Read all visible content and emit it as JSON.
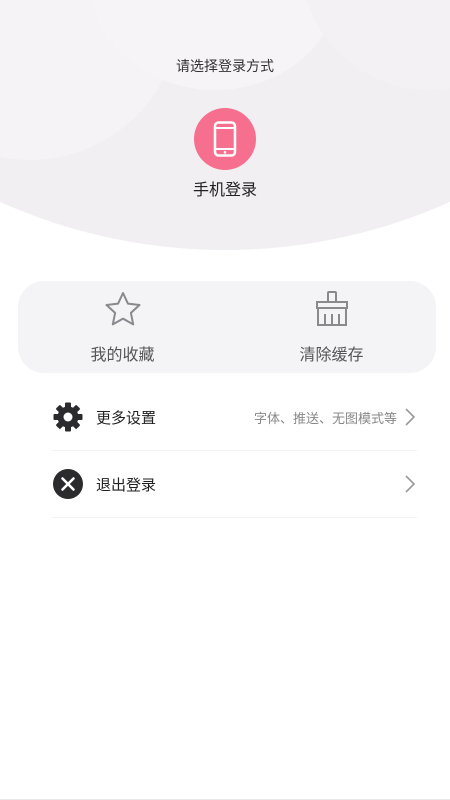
{
  "header": {
    "title": "请选择登录方式",
    "phone_login_label": "手机登录"
  },
  "quick_actions": {
    "favorites_label": "我的收藏",
    "clear_cache_label": "清除缓存"
  },
  "settings": {
    "items": [
      {
        "label": "更多设置",
        "hint": "字体、推送、无图模式等",
        "icon": "gear-icon"
      },
      {
        "label": "退出登录",
        "hint": "",
        "icon": "close-circle-icon"
      }
    ]
  },
  "colors": {
    "accent": "#f76f8e",
    "header_bg": "#f1eff2",
    "card_bg": "#f4f3f6"
  }
}
